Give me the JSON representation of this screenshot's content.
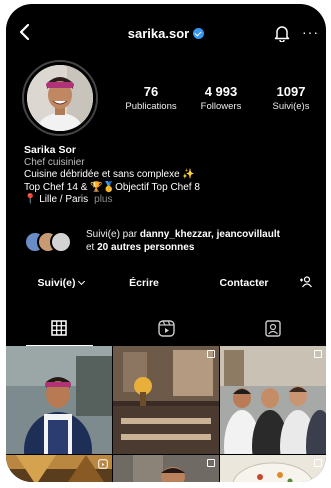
{
  "header": {
    "username": "sarika.sor"
  },
  "profile": {
    "stats": [
      {
        "value": "76",
        "label": "Publications"
      },
      {
        "value": "4 993",
        "label": "Followers"
      },
      {
        "value": "1097",
        "label": "Suivi(e)s"
      }
    ],
    "bio": {
      "name": "Sarika Sor",
      "category": "Chef cuisinier",
      "line1": "Cuisine débridée et sans complexe ✨",
      "line2_a": "Top Chef 14 & ",
      "line2_b": "🏆",
      "line2_c": "🥇",
      "line2_d": "Objectif Top Chef 8",
      "line3_pin": "📍",
      "line3": "Lille / Paris",
      "more": "plus"
    },
    "followed_by": {
      "prefix": "Suivi(e) par ",
      "names": "danny_khezzar, jeancovillault",
      "suffix_pre": "et ",
      "suffix": "20 autres personnes"
    }
  },
  "actions": {
    "following": "Suivi(e)",
    "message": "Écrire",
    "contact": "Contacter",
    "add_person": "+ᴙ"
  },
  "tabs": [
    "grid-icon",
    "reels-icon",
    "tagged-icon"
  ],
  "colors": {
    "background": "#000000",
    "verified": "#3897f0"
  }
}
